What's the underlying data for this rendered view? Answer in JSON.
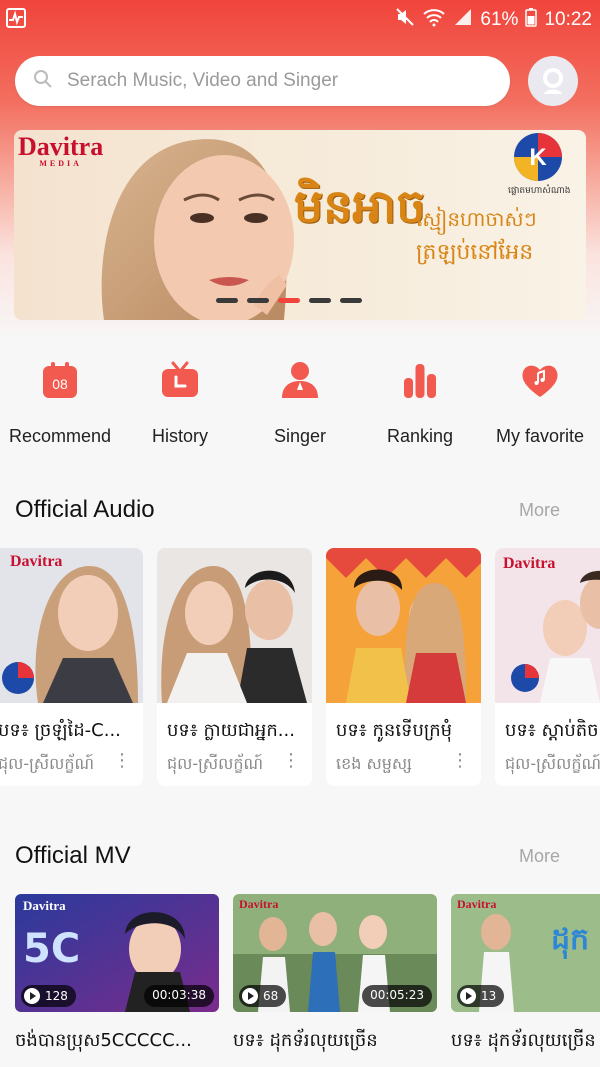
{
  "status_bar": {
    "battery_percent": "61%",
    "time": "10:22"
  },
  "search": {
    "placeholder": "Serach Music, Video and Singer"
  },
  "banner": {
    "brand_logo": "Davitra",
    "brand_logo_sub": "MEDIA",
    "title_khmer": "មិនអាច",
    "subtitle_line1": "ស្មៀនហាចាស់ៗ",
    "subtitle_line2": "ត្រឡប់នៅអែន",
    "corner_brand": "ផ្លោតមហាសំណាង",
    "slide_count": 5,
    "active_slide": 3
  },
  "quick_menu": [
    {
      "label": "Recommend",
      "icon": "calendar-icon",
      "badge": "08"
    },
    {
      "label": "History",
      "icon": "tv-history-icon"
    },
    {
      "label": "Singer",
      "icon": "singer-icon"
    },
    {
      "label": "Ranking",
      "icon": "ranking-bars-icon"
    },
    {
      "label": "My favorite",
      "icon": "heart-music-icon"
    }
  ],
  "official_audio": {
    "title": "Official Audio",
    "more_label": "More",
    "items": [
      {
        "title": "បទ៖ ច្រឡំដៃ-C...",
        "artist": "ជុល-ស្រីលក្ខ័ណ៍"
      },
      {
        "title": "បទ៖ ក្លាយជាអ្នក...",
        "artist": "ជុល-ស្រីលក្ខ័ណ៍"
      },
      {
        "title": "បទ៖ កូនទើបក្រមុំ",
        "artist": "ខេង សម្ផស្ស"
      },
      {
        "title": "បទ៖ ស្តាប់តិច",
        "artist": "ជុល-ស្រីលក្ខ័ណ៍"
      }
    ]
  },
  "official_mv": {
    "title": "Official MV",
    "more_label": "More",
    "items": [
      {
        "title": "ចង់បានប្រុស5CCCCC...",
        "plays": "128",
        "duration": "00:03:38"
      },
      {
        "title": "បទ៖ ដុកទ័រលុយច្រើន",
        "plays": "68",
        "duration": "00:05:23"
      },
      {
        "title": "បទ៖ ដុកទ័រលុយច្រើន",
        "plays": "13",
        "duration": ""
      }
    ]
  },
  "colors": {
    "accent": "#f0443c",
    "icon_red": "#f25a4f",
    "text_dark": "#222222",
    "muted": "#a7a7a7"
  }
}
